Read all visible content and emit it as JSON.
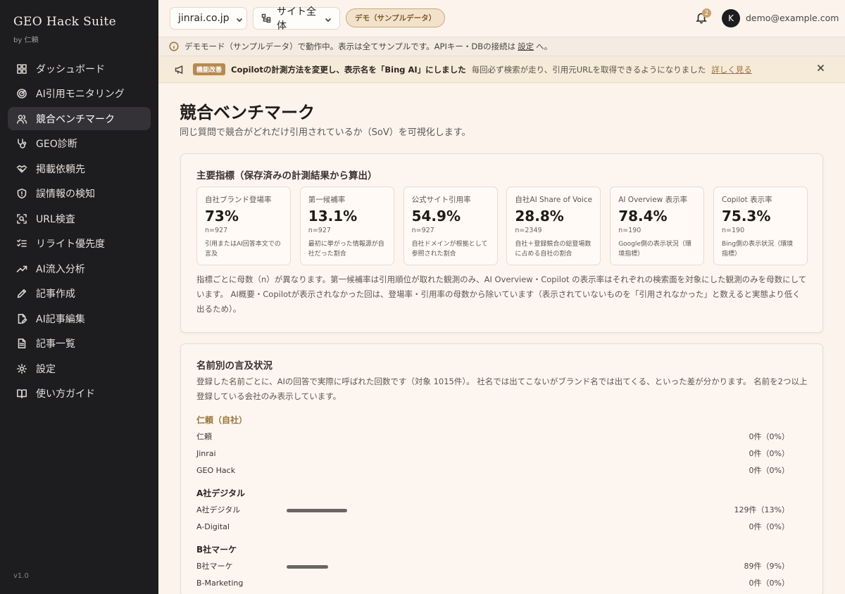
{
  "app": {
    "title": "GEO Hack Suite",
    "byline": "by 仁頼",
    "version": "v1.0"
  },
  "sidebar": {
    "items": [
      {
        "label": "ダッシュボード",
        "icon": "dashboard-icon",
        "active": false
      },
      {
        "label": "AI引用モニタリング",
        "icon": "radar-icon",
        "active": false
      },
      {
        "label": "競合ベンチマーク",
        "icon": "users-icon",
        "active": true
      },
      {
        "label": "GEO診断",
        "icon": "stethoscope-icon",
        "active": false
      },
      {
        "label": "掲載依頼先",
        "icon": "handshake-icon",
        "active": false
      },
      {
        "label": "誤情報の検知",
        "icon": "shield-alert-icon",
        "active": false
      },
      {
        "label": "URL検査",
        "icon": "scan-search-icon",
        "active": false
      },
      {
        "label": "リライト優先度",
        "icon": "list-checks-icon",
        "active": false
      },
      {
        "label": "AI流入分析",
        "icon": "trending-up-icon",
        "active": false
      },
      {
        "label": "記事作成",
        "icon": "pencil-icon",
        "active": false
      },
      {
        "label": "AI記事編集",
        "icon": "file-edit-icon",
        "active": false
      },
      {
        "label": "記事一覧",
        "icon": "file-text-icon",
        "active": false
      },
      {
        "label": "設定",
        "icon": "gear-icon",
        "active": false
      },
      {
        "label": "使い方ガイド",
        "icon": "book-open-icon",
        "active": false
      }
    ]
  },
  "topbar": {
    "domain_select": "jinrai.co.jp",
    "scope_select": "サイト全体",
    "demo_badge": "デモ（サンプルデータ）",
    "notification_count": "2",
    "avatar_initial": "K",
    "user_email": "demo@example.com"
  },
  "demo_notice": {
    "text_before": "デモモード（サンプルデータ）で動作中。表示は全てサンプルです。APIキー・DBの接続は",
    "link": "設定",
    "text_after": "へ。"
  },
  "update_banner": {
    "tag": "機能改善",
    "title": "Copilotの計測方法を変更し、表示名を「Bing AI」にしました",
    "description": "毎回必ず検索が走り、引用元URLを取得できるようになりました",
    "link": "詳しく見る"
  },
  "page": {
    "title": "競合ベンチマーク",
    "subtitle": "同じ質問で競合がどれだけ引用されているか（SoV）を可視化します。"
  },
  "metrics_card": {
    "title": "主要指標（保存済みの計測結果から算出）",
    "metrics": [
      {
        "label": "自社ブランド登場率",
        "value": "73%",
        "n": "n=927",
        "desc": "引用またはAI回答本文での言及"
      },
      {
        "label": "第一候補率",
        "value": "13.1%",
        "n": "n=927",
        "desc": "最初に挙がった情報源が自社だった割合"
      },
      {
        "label": "公式サイト引用率",
        "value": "54.9%",
        "n": "n=927",
        "desc": "自社ドメインが根拠として参照された割合"
      },
      {
        "label": "自社AI Share of Voice",
        "value": "28.8%",
        "n": "n=2349",
        "desc": "自社＋登録競合の総登場数に占める自社の割合"
      },
      {
        "label": "AI Overview 表示率",
        "value": "78.4%",
        "n": "n=190",
        "desc": "Google側の表示状況（環境指標）"
      },
      {
        "label": "Copilot 表示率",
        "value": "75.3%",
        "n": "n=190",
        "desc": "Bing側の表示状況（環境指標）"
      }
    ],
    "note": "指標ごとに母数（n）が異なります。第一候補率は引用順位が取れた観測のみ、AI Overview・Copilot の表示率はそれぞれの検索面を対象にした観測のみを母数にしています。 AI概要・Copilotが表示されなかった回は、登場率・引用率の母数から除いています（表示されていないものを「引用されなかった」と数えると実態より低く出るため）。"
  },
  "mentions_card": {
    "title": "名前別の言及状況",
    "description": "登録した名前ごとに、AIの回答で実際に呼ばれた回数です（対象 1015件）。 社名では出てこないがブランド名では出てくる、といった差が分かります。 名前を2つ以上登録している会社のみ表示しています。",
    "groups": [
      {
        "title": "仁頼（自社）",
        "self": true,
        "rows": [
          {
            "name": "仁頼",
            "value": "0件（0%）",
            "ratio": 0
          },
          {
            "name": "Jinrai",
            "value": "0件（0%）",
            "ratio": 0
          },
          {
            "name": "GEO Hack",
            "value": "0件（0%）",
            "ratio": 0
          }
        ]
      },
      {
        "title": "A社デジタル",
        "self": false,
        "rows": [
          {
            "name": "A社デジタル",
            "value": "129件（13%）",
            "ratio": 0.13
          },
          {
            "name": "A-Digital",
            "value": "0件（0%）",
            "ratio": 0
          }
        ]
      },
      {
        "title": "B社マーケ",
        "self": false,
        "rows": [
          {
            "name": "B社マーケ",
            "value": "89件（9%）",
            "ratio": 0.09
          },
          {
            "name": "B-Marketing",
            "value": "0件（0%）",
            "ratio": 0
          }
        ]
      }
    ]
  },
  "colors": {
    "sidebar_bg": "#1d1c1f",
    "accent": "#b58a52",
    "page_bg": "#fbf3ec"
  }
}
